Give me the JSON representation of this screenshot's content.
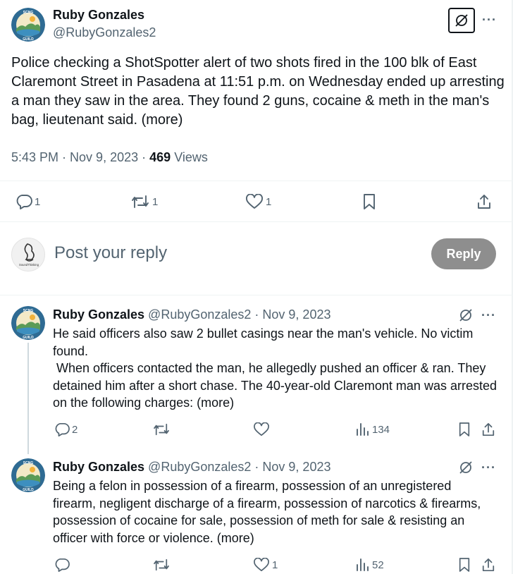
{
  "main_tweet": {
    "author_name": "Ruby Gonzales",
    "author_handle": "@RubyGonzales2",
    "avatar_text_top": "SCNG",
    "avatar_text_bottom": "GUILD",
    "text": "Police checking a ShotSpotter alert of two shots fired in the 100 blk of East Claremont Street in Pasadena at 11:51 p.m. on Wednesday ended up arresting a man they saw in the area. They found 2 guns, cocaine & meth in the man's bag, lieutenant said. (more)",
    "time": "5:43 PM",
    "date": "Nov 9, 2023",
    "views_count": "469",
    "views_label": "Views",
    "actions": {
      "reply_count": "1",
      "retweet_count": "1",
      "like_count": "1"
    }
  },
  "composer": {
    "avatar_label": "SoundThinking",
    "placeholder": "Post your reply",
    "reply_button": "Reply"
  },
  "replies": [
    {
      "author_name": "Ruby Gonzales",
      "author_handle": "@RubyGonzales2",
      "date": "Nov 9, 2023",
      "paragraph_1": "He said officers also saw 2 bullet casings near the man's vehicle. No victim found.",
      "paragraph_2": " When officers contacted the man, he allegedly pushed an officer & ran. They detained him after a short chase. The 40-year-old Claremont man was arrested on the following charges: (more)",
      "reply_count": "2",
      "retweet_count": "",
      "like_count": "",
      "views_count": "134"
    },
    {
      "author_name": "Ruby Gonzales",
      "author_handle": "@RubyGonzales2",
      "date": "Nov 9, 2023",
      "paragraph_1": "Being a felon in possession of a firearm, possession of an unregistered firearm, negligent discharge of a firearm, possession of narcotics & firearms, possession of cocaine for sale, possession of meth for sale & resisting an officer with force or violence. (more)",
      "reply_count": "",
      "retweet_count": "",
      "like_count": "1",
      "views_count": "52"
    }
  ],
  "separator": " · ",
  "more_glyph": "···"
}
